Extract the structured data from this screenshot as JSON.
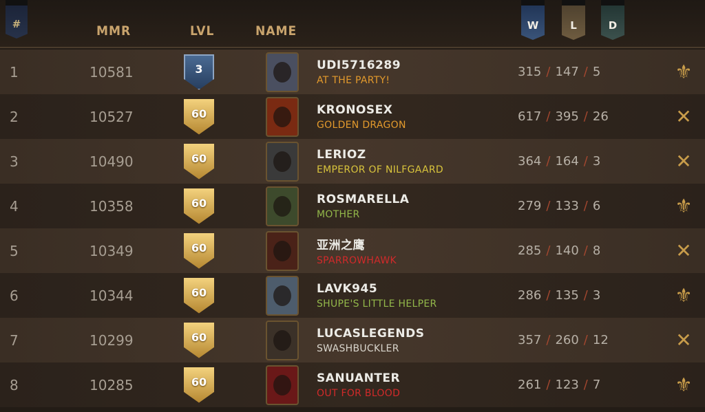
{
  "header": {
    "rank_label": "#",
    "mmr_label": "MMR",
    "lvl_label": "LVL",
    "name_label": "NAME",
    "w_label": "W",
    "l_label": "L",
    "d_label": "D"
  },
  "colors": {
    "orange": "#e39a2c",
    "yellow": "#d9c43c",
    "green": "#93b84a",
    "red": "#d12a2a",
    "white": "#dad6cd",
    "separator": "#a3472f"
  },
  "rows": [
    {
      "rank": "1",
      "mmr": "10581",
      "level": "3",
      "level_style": "blue",
      "player": "UDI5716289",
      "title": "AT THE PARTY!",
      "title_color": "#e39a2c",
      "w": "315",
      "l": "147",
      "d": "5",
      "faction_icon": "fleur-icon",
      "avatar_color": "#4a4f60"
    },
    {
      "rank": "2",
      "mmr": "10527",
      "level": "60",
      "level_style": "gold",
      "player": "KRONOSEX",
      "title": "GOLDEN DRAGON",
      "title_color": "#e39a2c",
      "w": "617",
      "l": "395",
      "d": "26",
      "faction_icon": "crossed-arrows-icon",
      "avatar_color": "#7a2a12"
    },
    {
      "rank": "3",
      "mmr": "10490",
      "level": "60",
      "level_style": "gold",
      "player": "LERIOZ",
      "title": "EMPEROR OF NILFGAARD",
      "title_color": "#d9c43c",
      "w": "364",
      "l": "164",
      "d": "3",
      "faction_icon": "crossed-arrows-icon",
      "avatar_color": "#3a3a3a"
    },
    {
      "rank": "4",
      "mmr": "10358",
      "level": "60",
      "level_style": "gold",
      "player": "ROSMARELLA",
      "title": "MOTHER",
      "title_color": "#93b84a",
      "w": "279",
      "l": "133",
      "d": "6",
      "faction_icon": "fleur-icon",
      "avatar_color": "#3d4a2c"
    },
    {
      "rank": "5",
      "mmr": "10349",
      "level": "60",
      "level_style": "gold",
      "player": "亚洲之鹰",
      "title": "SPARROWHAWK",
      "title_color": "#d12a2a",
      "w": "285",
      "l": "140",
      "d": "8",
      "faction_icon": "crossed-arrows-icon",
      "avatar_color": "#4a2218"
    },
    {
      "rank": "6",
      "mmr": "10344",
      "level": "60",
      "level_style": "gold",
      "player": "LAVK945",
      "title": "SHUPE'S LITTLE HELPER",
      "title_color": "#93b84a",
      "w": "286",
      "l": "135",
      "d": "3",
      "faction_icon": "fleur-icon",
      "avatar_color": "#4d5c6c"
    },
    {
      "rank": "7",
      "mmr": "10299",
      "level": "60",
      "level_style": "gold",
      "player": "LUCASLEGENDS",
      "title": "SWASHBUCKLER",
      "title_color": "#dad6cd",
      "w": "357",
      "l": "260",
      "d": "12",
      "faction_icon": "crossed-arrows-icon",
      "avatar_color": "#3b3128"
    },
    {
      "rank": "8",
      "mmr": "10285",
      "level": "60",
      "level_style": "gold",
      "player": "SANUANTER",
      "title": "OUT FOR BLOOD",
      "title_color": "#d12a2a",
      "w": "261",
      "l": "123",
      "d": "7",
      "faction_icon": "fleur-icon",
      "avatar_color": "#6a1818"
    }
  ]
}
